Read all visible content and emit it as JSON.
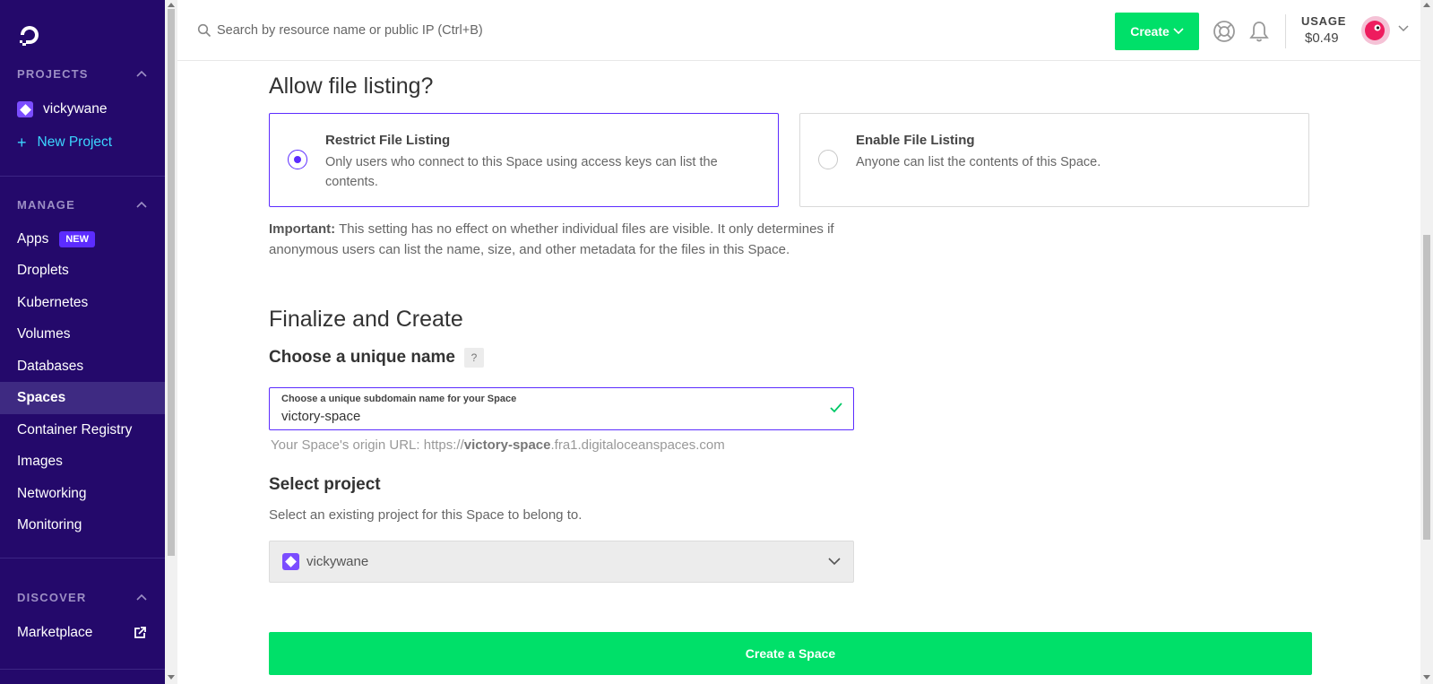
{
  "sidebar": {
    "logo": "digitalocean-logo",
    "projects_heading": "PROJECTS",
    "projects": [
      {
        "label": "vickywane"
      }
    ],
    "new_project": "New Project",
    "manage_heading": "MANAGE",
    "manage_items": [
      {
        "label": "Apps",
        "badge": "NEW"
      },
      {
        "label": "Droplets"
      },
      {
        "label": "Kubernetes"
      },
      {
        "label": "Volumes"
      },
      {
        "label": "Databases"
      },
      {
        "label": "Spaces",
        "active": true
      },
      {
        "label": "Container Registry"
      },
      {
        "label": "Images"
      },
      {
        "label": "Networking"
      },
      {
        "label": "Monitoring"
      }
    ],
    "discover_heading": "DISCOVER",
    "discover_items": [
      {
        "label": "Marketplace",
        "icon": "external-link-icon"
      }
    ]
  },
  "topbar": {
    "search_placeholder": "Search by resource name or public IP (Ctrl+B)",
    "create_label": "Create",
    "usage_label": "USAGE",
    "usage_value": "$0.49"
  },
  "file_listing": {
    "heading": "Allow file listing?",
    "options": [
      {
        "title": "Restrict File Listing",
        "description": "Only users who connect to this Space using access keys can list the contents.",
        "selected": true
      },
      {
        "title": "Enable File Listing",
        "description": "Anyone can list the contents of this Space.",
        "selected": false
      }
    ],
    "important_label": "Important:",
    "important_text": " This setting has no effect on whether individual files are visible. It only determines if anonymous users can list the name, size, and other metadata for the files in this Space."
  },
  "finalize": {
    "heading": "Finalize and Create",
    "name_heading": "Choose a unique name",
    "help_mark": "?",
    "name_field_label": "Choose a unique subdomain name for your Space",
    "name_value": "victory-space",
    "origin_prefix": "Your Space's origin URL: https://",
    "origin_name": "victory-space",
    "origin_suffix": ".fra1.digitaloceanspaces.com",
    "project_heading": "Select project",
    "project_desc": "Select an existing project for this Space to belong to.",
    "project_selected": "vickywane",
    "submit_label": "Create a Space"
  },
  "colors": {
    "sidebar_bg": "#24096b",
    "accent": "#5c2cff",
    "primary_button": "#00e069",
    "link_cyan": "#3bd6ff"
  }
}
